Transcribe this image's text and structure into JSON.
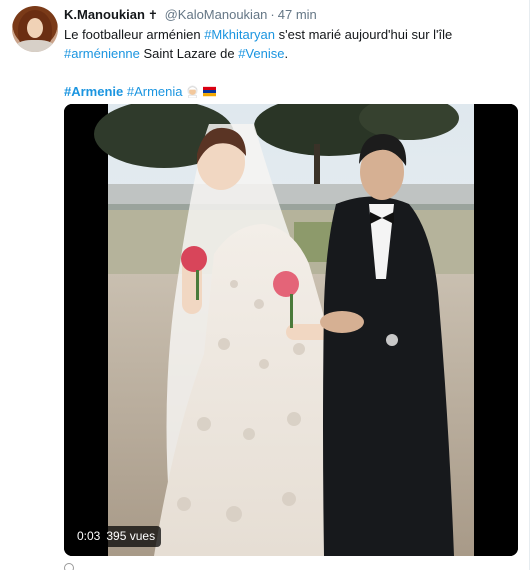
{
  "tweet": {
    "author_name": "K.Manoukian",
    "author_badge": "✝",
    "author_handle": "@KaloManoukian",
    "separator": "·",
    "timestamp": "47 min",
    "text_part1": "Le footballeur arménien ",
    "hashtag_mkhitaryan": "#Mkhitaryan",
    "text_part2": " s'est marié aujourd'hui sur l'île ",
    "hashtag_armenienne": "#arménienne",
    "text_part3": " Saint Lazare de ",
    "hashtag_venise": "#Venise",
    "text_part4": ".",
    "hashtag_armenie": "#Armenie",
    "hashtag_armenia": "#Armenia",
    "emoji_icons": [
      "bride-emoji",
      "armenia-flag"
    ]
  },
  "video": {
    "elapsed": "0:03",
    "views": "395 vues"
  },
  "colors": {
    "link": "#1b95e0",
    "text": "#14171a",
    "secondary": "#657786"
  }
}
